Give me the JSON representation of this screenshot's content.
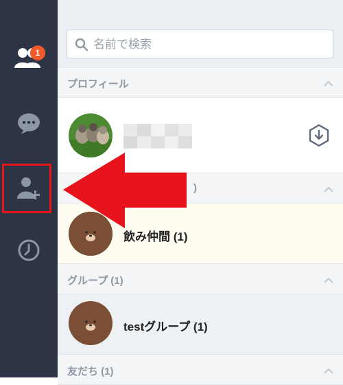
{
  "sidebar": {
    "badge_count": "1",
    "items": [
      {
        "icon": "friends-icon",
        "label": "friends",
        "active": true
      },
      {
        "icon": "chat-icon",
        "label": "chats"
      },
      {
        "icon": "add-friend-icon",
        "label": "add friend"
      },
      {
        "icon": "history-icon",
        "label": "history"
      }
    ],
    "highlight_color": "#e8141b"
  },
  "search": {
    "placeholder": "名前で検索"
  },
  "sections": {
    "profile": {
      "label": "プロフィール"
    },
    "hidden": {
      "label": ")"
    },
    "groups": {
      "label": "グループ (1)"
    },
    "friends": {
      "label": "友だち (1)"
    }
  },
  "profile": {
    "name": ""
  },
  "favorites_row": {
    "name": "飲み仲間 (1)",
    "background": "#fffdf1"
  },
  "group_row": {
    "name": "testグループ (1)",
    "background": "#eef1f4"
  },
  "colors": {
    "rail": "#2c3445",
    "accent": "#f0592a",
    "arrow": "#e8141b",
    "section_text": "#8e97a3"
  }
}
